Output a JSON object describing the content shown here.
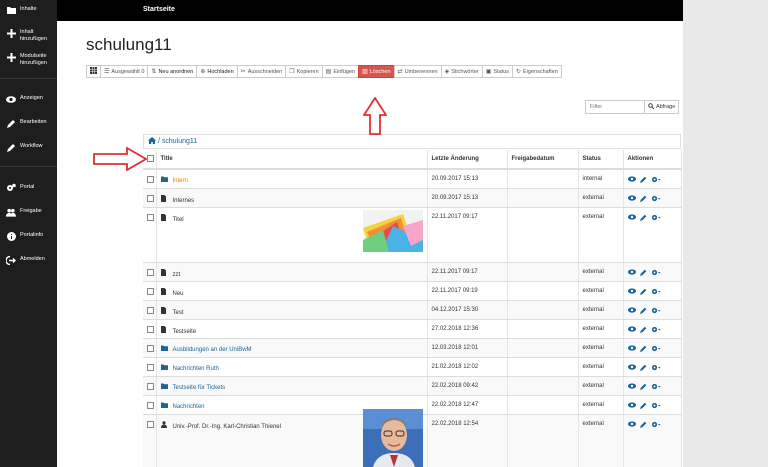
{
  "sidebar": {
    "items": [
      {
        "label": "Inhalte",
        "icon": "folder-icon"
      },
      {
        "label": "Inhalt\nhinzufügen",
        "icon": "plus-icon"
      },
      {
        "label": "Modulseite\nhinzufügen",
        "icon": "plus-icon"
      },
      {
        "label": "Anzeigen",
        "icon": "eye-icon"
      },
      {
        "label": "Bearbeiten",
        "icon": "pencil-icon"
      },
      {
        "label": "Workflow",
        "icon": "pencil-icon"
      },
      {
        "label": "Portal",
        "icon": "cogs-icon"
      },
      {
        "label": "Freigabe",
        "icon": "users-icon"
      },
      {
        "label": "Portalinfo",
        "icon": "info-icon"
      },
      {
        "label": "Abmelden",
        "icon": "logout-icon"
      }
    ]
  },
  "topbar": {
    "title": "Startseite"
  },
  "page": {
    "title": "schulung11"
  },
  "toolbar": {
    "select_all": "",
    "selected": "Ausgewählt 0",
    "reorder": "Neu anordnen",
    "upload": "Hochladen",
    "cut": "Ausschneiden",
    "copy": "Kopieren",
    "paste": "Einfügen",
    "delete": "Löschen",
    "rename": "Umbenennen",
    "tags": "Stichwörter",
    "status": "Status",
    "properties": "Eigenschaften"
  },
  "filter": {
    "placeholder": "Filter",
    "button": "Abfrage"
  },
  "breadcrumb": {
    "path": "/ schulung11"
  },
  "table": {
    "columns": [
      "Title",
      "Letzte Änderung",
      "Freigabedatum",
      "Status",
      "Aktionen"
    ],
    "rows": [
      {
        "title": "Intern",
        "type": "folder",
        "modified": "20.09.2017 15:13",
        "published": "",
        "status": "internal"
      },
      {
        "title": "Internes",
        "type": "file",
        "modified": "20.09.2017 15:13",
        "published": "",
        "status": "external"
      },
      {
        "title": "Titel",
        "type": "file",
        "modified": "22.11.2017 09:17",
        "published": "",
        "status": "external"
      },
      {
        "title": "zzt",
        "type": "file",
        "modified": "22.11.2017 09:17",
        "published": "",
        "status": "external"
      },
      {
        "title": "Neu",
        "type": "file",
        "modified": "22.11.2017 09:19",
        "published": "",
        "status": "external"
      },
      {
        "title": "Test",
        "type": "file",
        "modified": "04.12.2017 15:30",
        "published": "",
        "status": "external"
      },
      {
        "title": "Testseite",
        "type": "file",
        "modified": "27.02.2018 12:36",
        "published": "",
        "status": "external"
      },
      {
        "title": "Ausbildungen an der UniBwM",
        "type": "folder",
        "modified": "12.03.2018 12:01",
        "published": "",
        "status": "external"
      },
      {
        "title": "Nachrichten Ruth",
        "type": "folder",
        "modified": "21.02.2018 12:02",
        "published": "",
        "status": "external"
      },
      {
        "title": "Testseite für Tickets",
        "type": "folder",
        "modified": "22.02.2018 09:42",
        "published": "",
        "status": "external"
      },
      {
        "title": "Nachrichten",
        "type": "folder",
        "modified": "22.02.2018 12:47",
        "published": "",
        "status": "external"
      },
      {
        "title": "Univ.-Prof. Dr.-Ing. Karl-Christian Thienel",
        "type": "person",
        "modified": "22.02.2018 12:54",
        "published": "",
        "status": "external"
      }
    ]
  },
  "colors": {
    "accent": "#1a6496",
    "danger": "#d9534f",
    "warning": "#e87e04",
    "annotation": "#e03030"
  }
}
